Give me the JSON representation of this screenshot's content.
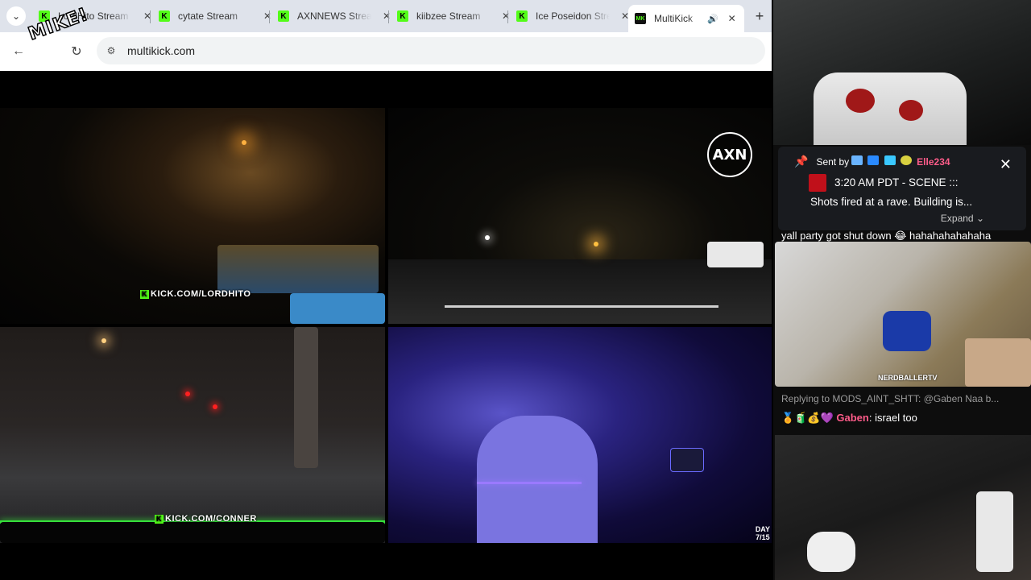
{
  "browser": {
    "tabs": [
      {
        "title": "LordHito Stream",
        "favicon": "kick-icon"
      },
      {
        "title": "cytate Stream",
        "favicon": "kick-icon"
      },
      {
        "title": "AXNNEWS Stream",
        "favicon": "kick-icon"
      },
      {
        "title": "kiibzee Stream",
        "favicon": "kick-icon"
      },
      {
        "title": "Ice Poseidon Stream",
        "favicon": "kick-icon"
      },
      {
        "title": "MultiKick",
        "favicon": "multikick-icon",
        "active": true
      }
    ],
    "url": "multikick.com",
    "overlay_logo": "MIKE!"
  },
  "streams": [
    {
      "watermark": "KICK.COM/LORDHITO"
    },
    {
      "logo_text": "AXN"
    },
    {
      "watermark": "KICK.COM/CONNER"
    },
    {
      "badge_line1": "DAY",
      "badge_line2": "7/15"
    }
  ],
  "chat": {
    "pinned": {
      "sent_by_label": "Sent by",
      "username": "Elle234",
      "line1": "3:20 AM PDT - SCENE :::",
      "line2": "Shots fired at a rave. Building is...",
      "expand_label": "Expand"
    },
    "message1": "yall party got shut down 😂 hahahahahahaha",
    "mid_cam_tag": "NERDBALLERTV",
    "reply": "Replying to MODS_AINT_SHTT: @Gaben Naa b...",
    "message2_user": "Gaben",
    "message2_text": "israel too"
  },
  "colors": {
    "kick_green": "#53fc18",
    "username_pink": "#ff5c8a"
  }
}
